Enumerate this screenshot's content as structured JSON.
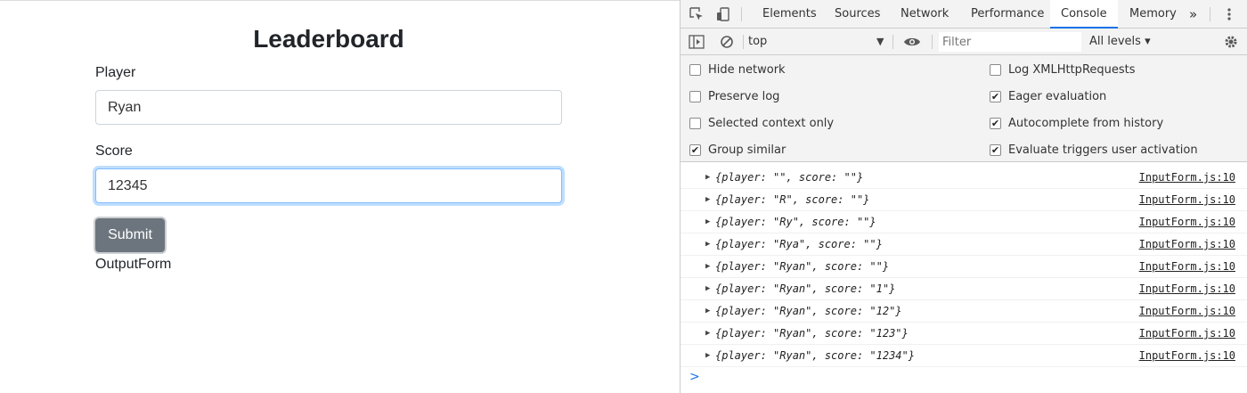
{
  "app": {
    "title": "Leaderboard",
    "player_label": "Player",
    "player_value": "Ryan",
    "score_label": "Score",
    "score_value": "12345",
    "submit_label": "Submit",
    "output_label": "OutputForm"
  },
  "devtools": {
    "tabs": [
      "Elements",
      "Sources",
      "Network",
      "Performance",
      "Console",
      "Memory"
    ],
    "active_tab": "Console",
    "more_tabs": "»",
    "context": "top",
    "filter_placeholder": "Filter",
    "levels": "All levels ▾",
    "settings": [
      {
        "label": "Hide network",
        "checked": false
      },
      {
        "label": "Log XMLHttpRequests",
        "checked": false
      },
      {
        "label": "Preserve log",
        "checked": false
      },
      {
        "label": "Eager evaluation",
        "checked": true
      },
      {
        "label": "Selected context only",
        "checked": false
      },
      {
        "label": "Autocomplete from history",
        "checked": true
      },
      {
        "label": "Group similar",
        "checked": true
      },
      {
        "label": "Evaluate triggers user activation",
        "checked": true
      }
    ],
    "logs": [
      {
        "message": "{player: \"\", score: \"\"}",
        "source": "InputForm.js:10"
      },
      {
        "message": "{player: \"R\", score: \"\"}",
        "source": "InputForm.js:10"
      },
      {
        "message": "{player: \"Ry\", score: \"\"}",
        "source": "InputForm.js:10"
      },
      {
        "message": "{player: \"Rya\", score: \"\"}",
        "source": "InputForm.js:10"
      },
      {
        "message": "{player: \"Ryan\", score: \"\"}",
        "source": "InputForm.js:10"
      },
      {
        "message": "{player: \"Ryan\", score: \"1\"}",
        "source": "InputForm.js:10"
      },
      {
        "message": "{player: \"Ryan\", score: \"12\"}",
        "source": "InputForm.js:10"
      },
      {
        "message": "{player: \"Ryan\", score: \"123\"}",
        "source": "InputForm.js:10"
      },
      {
        "message": "{player: \"Ryan\", score: \"1234\"}",
        "source": "InputForm.js:10"
      }
    ],
    "prompt_symbol": ">"
  }
}
